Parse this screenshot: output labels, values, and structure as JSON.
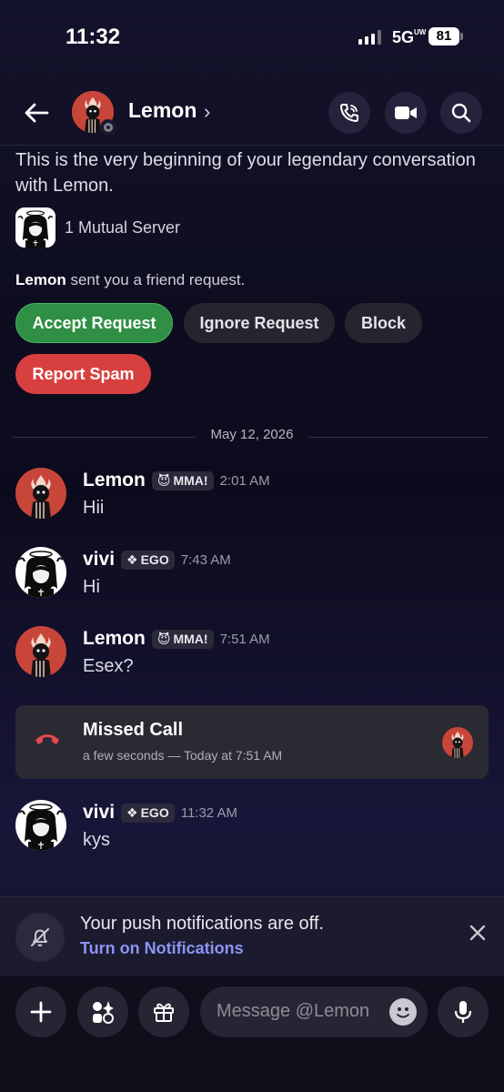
{
  "status_bar": {
    "time": "11:32",
    "network": "5G",
    "network_sub": "UW",
    "battery": "81"
  },
  "header": {
    "name": "Lemon",
    "chevron": "›"
  },
  "intro": {
    "text": "This is the very beginning of your legendary conversation with Lemon.",
    "mutual": "1 Mutual Server"
  },
  "friend_request": {
    "sender": "Lemon",
    "text": " sent you a friend request.",
    "accept": "Accept Request",
    "ignore": "Ignore Request",
    "block": "Block",
    "report": "Report Spam"
  },
  "divider": {
    "date": "May 12, 2026"
  },
  "messages": [
    {
      "author": "Lemon",
      "tag": "MMA!",
      "time": "2:01 AM",
      "text": "Hii"
    },
    {
      "author": "vivi",
      "tag": "EGO",
      "time": "7:43 AM",
      "text": "Hi"
    },
    {
      "author": "Lemon",
      "tag": "MMA!",
      "time": "7:51 AM",
      "text": "Esex?"
    },
    {
      "author": "vivi",
      "tag": "EGO",
      "time": "11:32 AM",
      "text": "kys"
    }
  ],
  "missed_call": {
    "title": "Missed Call",
    "subtitle": "a few seconds — Today at 7:51 AM"
  },
  "notification": {
    "title": "Your push notifications are off.",
    "link": "Turn on Notifications"
  },
  "composer": {
    "placeholder": "Message @Lemon"
  },
  "colors": {
    "accept": "#2f8f44",
    "report": "#d8403f",
    "link": "#8c95f5",
    "avatar_red": "#c8453a"
  }
}
